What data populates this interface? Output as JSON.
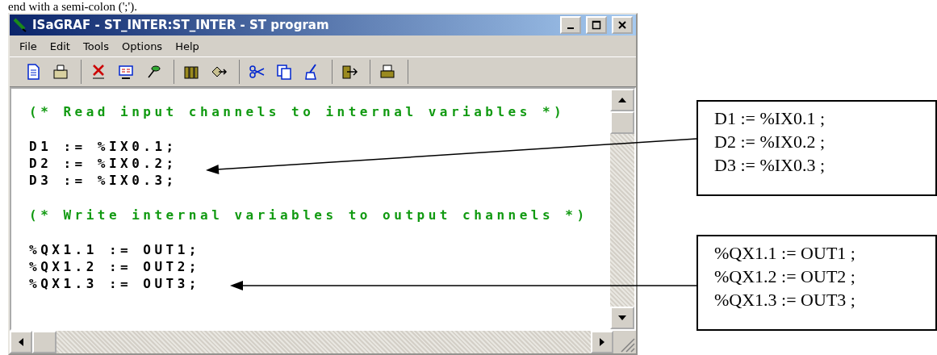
{
  "caption": "end with a semi-colon (';').",
  "window": {
    "title": "ISaGRAF - ST_INTER:ST_INTER - ST program"
  },
  "menu": [
    "File",
    "Edit",
    "Tools",
    "Options",
    "Help"
  ],
  "code_blocks": [
    {
      "comment": "(* Read input channels to internal variables *)",
      "lines": [
        "D1 := %IX0.1;",
        "D2 := %IX0.2;",
        "D3 := %IX0.3;"
      ]
    },
    {
      "comment": "(* Write internal variables to output channels *)",
      "lines": [
        "%QX1.1 := OUT1;",
        "%QX1.2 := OUT2;",
        "%QX1.3 := OUT3;"
      ]
    }
  ],
  "callouts": [
    {
      "lines": [
        "D1 := %IX0.1 ;",
        "D2 := %IX0.2 ;",
        "D3 := %IX0.3 ;"
      ]
    },
    {
      "lines": [
        "%QX1.1 := OUT1 ;",
        "%QX1.2 := OUT2 ;",
        "%QX1.3 := OUT3 ;"
      ]
    }
  ]
}
